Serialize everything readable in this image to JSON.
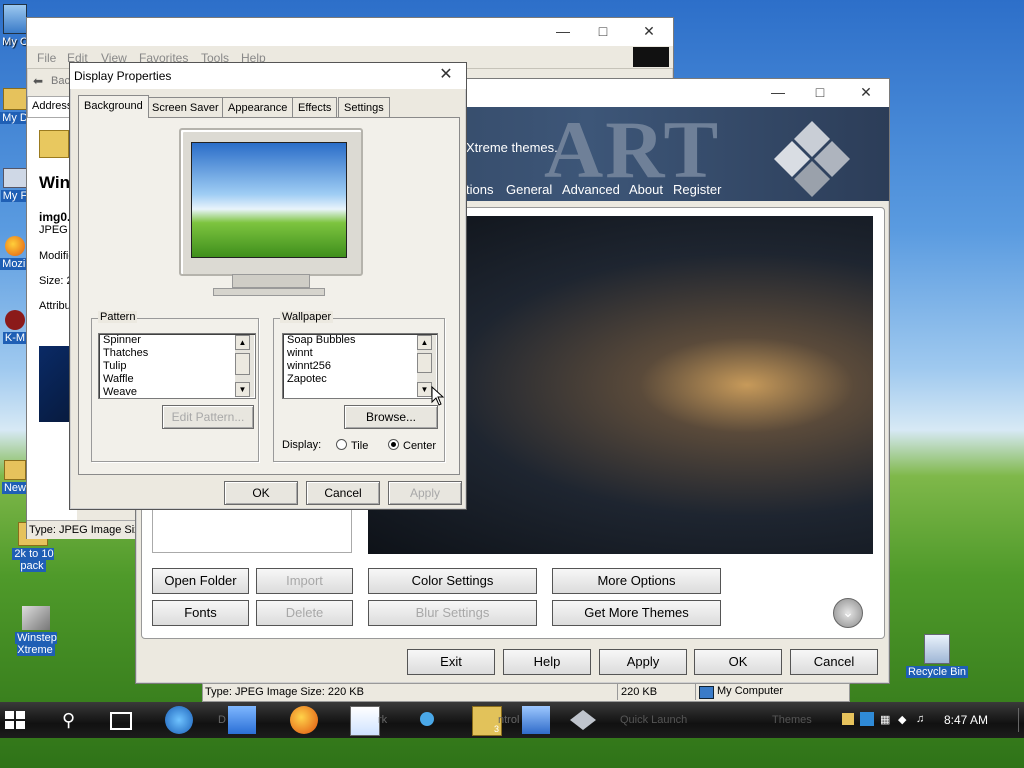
{
  "desktop": {
    "icons": [
      {
        "label": "My C"
      },
      {
        "label": "My D"
      },
      {
        "label": "My F"
      },
      {
        "label": "Mozil"
      },
      {
        "label": "K-M"
      },
      {
        "label": "New"
      },
      {
        "label": "2k to 10 pack"
      },
      {
        "label": "Winstep Xtreme"
      },
      {
        "label": "Recycle Bin"
      }
    ]
  },
  "explorer": {
    "menu": [
      "File",
      "Edit",
      "View",
      "Favorites",
      "Tools",
      "Help"
    ],
    "back_label": "Bac",
    "address_label": "Address",
    "heading": "Win",
    "file_name": "img0.",
    "file_type": "JPEG I",
    "modified_label": "Modifie",
    "size_label": "Size: 2",
    "attributes_label": "Attribu",
    "status": "Type: JPEG Image Size"
  },
  "xtreme": {
    "logo_text": "ART",
    "tagline": "Xtreme themes.",
    "menu": [
      "tions",
      "General",
      "Advanced",
      "About",
      "Register"
    ],
    "buttons_row1": [
      "Open Folder",
      "Import",
      "Color Settings",
      "More Options"
    ],
    "buttons_row2": [
      "Fonts",
      "Delete",
      "Blur Settings",
      "Get More Themes"
    ],
    "footer_buttons": [
      "Exit",
      "Help",
      "Apply",
      "OK",
      "Cancel"
    ],
    "status_left": "Type: JPEG Image Size: 220 KB",
    "status_size": "220 KB",
    "status_location": "My Computer"
  },
  "display_properties": {
    "title": "Display Properties",
    "tabs": [
      "Background",
      "Screen Saver",
      "Appearance",
      "Effects",
      "Settings"
    ],
    "pattern": {
      "label": "Pattern",
      "items": [
        "Spinner",
        "Thatches",
        "Tulip",
        "Waffle",
        "Weave"
      ],
      "edit_button": "Edit Pattern..."
    },
    "wallpaper": {
      "label": "Wallpaper",
      "items": [
        "Soap Bubbles",
        "winnt",
        "winnt256",
        "Zapotec"
      ],
      "browse_button": "Browse...",
      "display_label": "Display:",
      "option_tile": "Tile",
      "option_center": "Center",
      "selected": "Center"
    },
    "buttons": {
      "ok": "OK",
      "cancel": "Cancel",
      "apply": "Apply"
    }
  },
  "taskbar": {
    "items": [
      "D",
      "ntrol",
      "rk",
      "Quick Launch",
      "Themes"
    ],
    "folder_count": "3",
    "clock": "8:47 AM"
  }
}
